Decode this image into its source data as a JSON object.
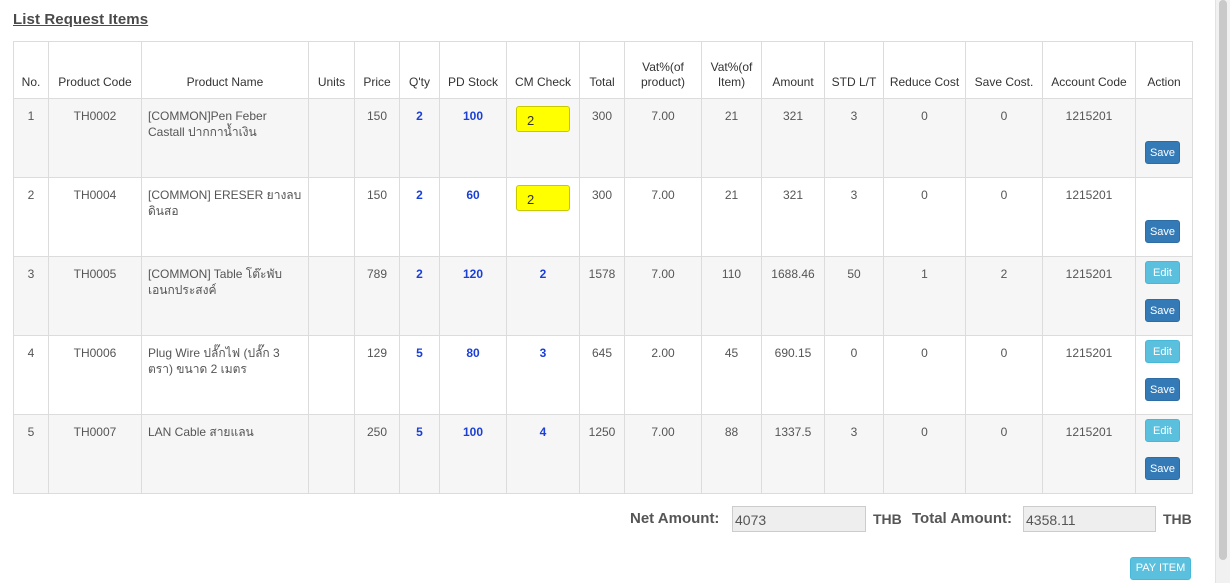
{
  "section_title": "List Request Items",
  "columns": [
    "No.",
    "Product Code",
    "Product Name",
    "Units",
    "Price",
    "Q'ty",
    "PD Stock",
    "CM Check",
    "Total",
    "Vat%(of product)",
    "Vat%(of Item)",
    "Amount",
    "STD L/T",
    "Reduce Cost",
    "Save Cost.",
    "Account Code",
    "Action"
  ],
  "rows": [
    {
      "no": "1",
      "code": "TH0002",
      "name": "[COMMON]Pen Feber Castall ปากกาน้ำเงิน",
      "units": "",
      "price": "150",
      "qty": "2",
      "pd_stock": "100",
      "cm_check": "2",
      "total": "300",
      "vat_product": "7.00",
      "vat_item": "21",
      "amount": "321",
      "std_lt": "3",
      "reduce_cost": "0",
      "save_cost": "0",
      "account": "1215201",
      "edit_label": "",
      "save_label": "Save"
    },
    {
      "no": "2",
      "code": "TH0004",
      "name": "[COMMON] ERESER ยางลบดินสอ",
      "units": "",
      "price": "150",
      "qty": "2",
      "pd_stock": "60",
      "cm_check": "2",
      "total": "300",
      "vat_product": "7.00",
      "vat_item": "21",
      "amount": "321",
      "std_lt": "3",
      "reduce_cost": "0",
      "save_cost": "0",
      "account": "1215201",
      "edit_label": "",
      "save_label": "Save"
    },
    {
      "no": "3",
      "code": "TH0005",
      "name": "[COMMON] Table โต๊ะพับเอนกประสงค์",
      "units": "",
      "price": "789",
      "qty": "2",
      "pd_stock": "120",
      "cm_check": "2",
      "total": "1578",
      "vat_product": "7.00",
      "vat_item": "110",
      "amount": "1688.46",
      "std_lt": "50",
      "reduce_cost": "1",
      "save_cost": "2",
      "account": "1215201",
      "edit_label": "Edit",
      "save_label": "Save"
    },
    {
      "no": "4",
      "code": "TH0006",
      "name": "Plug Wire ปลั๊กไฟ (ปลั๊ก 3 ตรา) ขนาด 2 เมตร",
      "units": "",
      "price": "129",
      "qty": "5",
      "pd_stock": "80",
      "cm_check": "3",
      "total": "645",
      "vat_product": "2.00",
      "vat_item": "45",
      "amount": "690.15",
      "std_lt": "0",
      "reduce_cost": "0",
      "save_cost": "0",
      "account": "1215201",
      "edit_label": "Edit",
      "save_label": "Save"
    },
    {
      "no": "5",
      "code": "TH0007",
      "name": "LAN Cable สายแลน",
      "units": "",
      "price": "250",
      "qty": "5",
      "pd_stock": "100",
      "cm_check": "4",
      "total": "1250",
      "vat_product": "7.00",
      "vat_item": "88",
      "amount": "1337.5",
      "std_lt": "3",
      "reduce_cost": "0",
      "save_cost": "0",
      "account": "1215201",
      "edit_label": "Edit",
      "save_label": "Save"
    }
  ],
  "totals": {
    "net_label": "Net Amount:",
    "net_value": "4073",
    "net_unit": "THB",
    "total_label": "Total Amount:",
    "total_value": "4358.11",
    "total_unit": "THB"
  },
  "pay_button": "PAY ITEM",
  "colors": {
    "cm_input_bg": "#ffff00",
    "save_button": "#337ab7",
    "edit_button": "#5bc0de",
    "blue_value": "#1a3fd6"
  }
}
